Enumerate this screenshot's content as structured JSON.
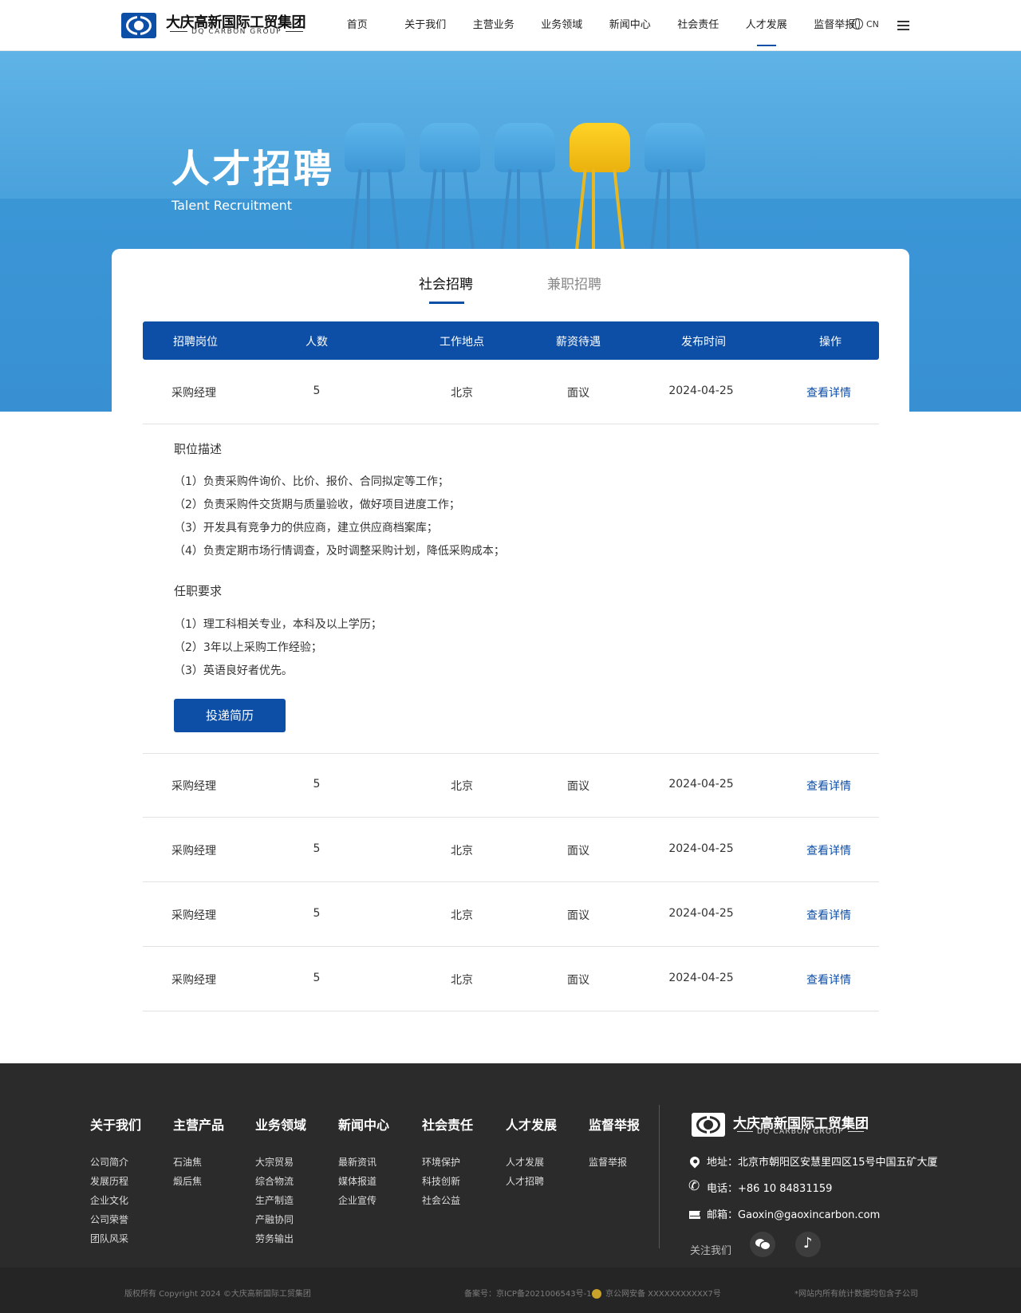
{
  "header": {
    "logo_cn": "大庆高新国际工贸集团",
    "logo_en": "DQ CARBON GROUP",
    "nav": [
      "首页",
      "关于我们",
      "主营业务",
      "业务领域",
      "新闻中心",
      "社会责任",
      "人才发展",
      "监督举报"
    ],
    "active_nav": "人才发展",
    "lang": "CN"
  },
  "banner": {
    "title": "人才招聘",
    "subtitle": "Talent Recruitment"
  },
  "tabs": {
    "social": "社会招聘",
    "parttime": "兼职招聘",
    "active": "社会招聘"
  },
  "table": {
    "headers": [
      "招聘岗位",
      "人数",
      "工作地点",
      "薪资待遇",
      "发布时间",
      "操作"
    ],
    "rows": [
      {
        "position": "采购经理",
        "count": "5",
        "location": "北京",
        "salary": "面议",
        "date": "2024-04-25",
        "action": "查看详情"
      },
      {
        "position": "采购经理",
        "count": "5",
        "location": "北京",
        "salary": "面议",
        "date": "2024-04-25",
        "action": "查看详情"
      },
      {
        "position": "采购经理",
        "count": "5",
        "location": "北京",
        "salary": "面议",
        "date": "2024-04-25",
        "action": "查看详情"
      },
      {
        "position": "采购经理",
        "count": "5",
        "location": "北京",
        "salary": "面议",
        "date": "2024-04-25",
        "action": "查看详情"
      },
      {
        "position": "采购经理",
        "count": "5",
        "location": "北京",
        "salary": "面议",
        "date": "2024-04-25",
        "action": "查看详情"
      }
    ]
  },
  "detail": {
    "desc_title": "职位描述",
    "desc": [
      "（1）负责采购件询价、比价、报价、合同拟定等工作；",
      "（2）负责采购件交货期与质量验收，做好项目进度工作；",
      "（3）开发具有竞争力的供应商，建立供应商档案库；",
      "（4）负责定期市场行情调查，及时调整采购计划，降低采购成本；"
    ],
    "req_title": "任职要求",
    "req": [
      "（1）理工科相关专业，本科及以上学历；",
      "（2）3年以上采购工作经验；",
      "（3）英语良好者优先。"
    ],
    "apply_label": "投递简历"
  },
  "footer": {
    "columns": [
      {
        "title": "关于我们",
        "links": [
          "公司简介",
          "发展历程",
          "企业文化",
          "公司荣誉",
          "团队风采"
        ]
      },
      {
        "title": "主营产品",
        "links": [
          "石油焦",
          "煅后焦"
        ]
      },
      {
        "title": "业务领域",
        "links": [
          "大宗贸易",
          "综合物流",
          "生产制造",
          "产融协同",
          "劳务输出"
        ]
      },
      {
        "title": "新闻中心",
        "links": [
          "最新资讯",
          "媒体报道",
          "企业宣传"
        ]
      },
      {
        "title": "社会责任",
        "links": [
          "环境保护",
          "科技创新",
          "社会公益"
        ]
      },
      {
        "title": "人才发展",
        "links": [
          "人才发展",
          "人才招聘"
        ]
      },
      {
        "title": "监督举报",
        "links": [
          "监督举报"
        ]
      }
    ],
    "logo_cn": "大庆高新国际工贸集团",
    "logo_en": "DQ CARBON GROUP",
    "address": "地址：北京市朝阳区安慧里四区15号中国五矿大厦",
    "phone": "电话：+86 10 84831159",
    "email": "邮箱：Gaoxin@gaoxincarbon.com",
    "follow": "关注我们",
    "copyright": "版权所有 Copyright 2024 ©大庆高新国际工贸集团",
    "icp": "备案号：京ICP备2021006543号-1",
    "police": "京公网安备 XXXXXXXXXXX7号",
    "note": "*网站内所有统计数据均包含子公司"
  },
  "colors": {
    "primary": "#0d4ea6",
    "footer_bg": "#2b2b2b",
    "accent_chair": "#f5c518"
  },
  "icons": [
    "globe-icon",
    "menu-icon",
    "location-icon",
    "phone-icon",
    "mail-icon",
    "wechat-icon",
    "tiktok-icon",
    "police-badge-icon"
  ]
}
